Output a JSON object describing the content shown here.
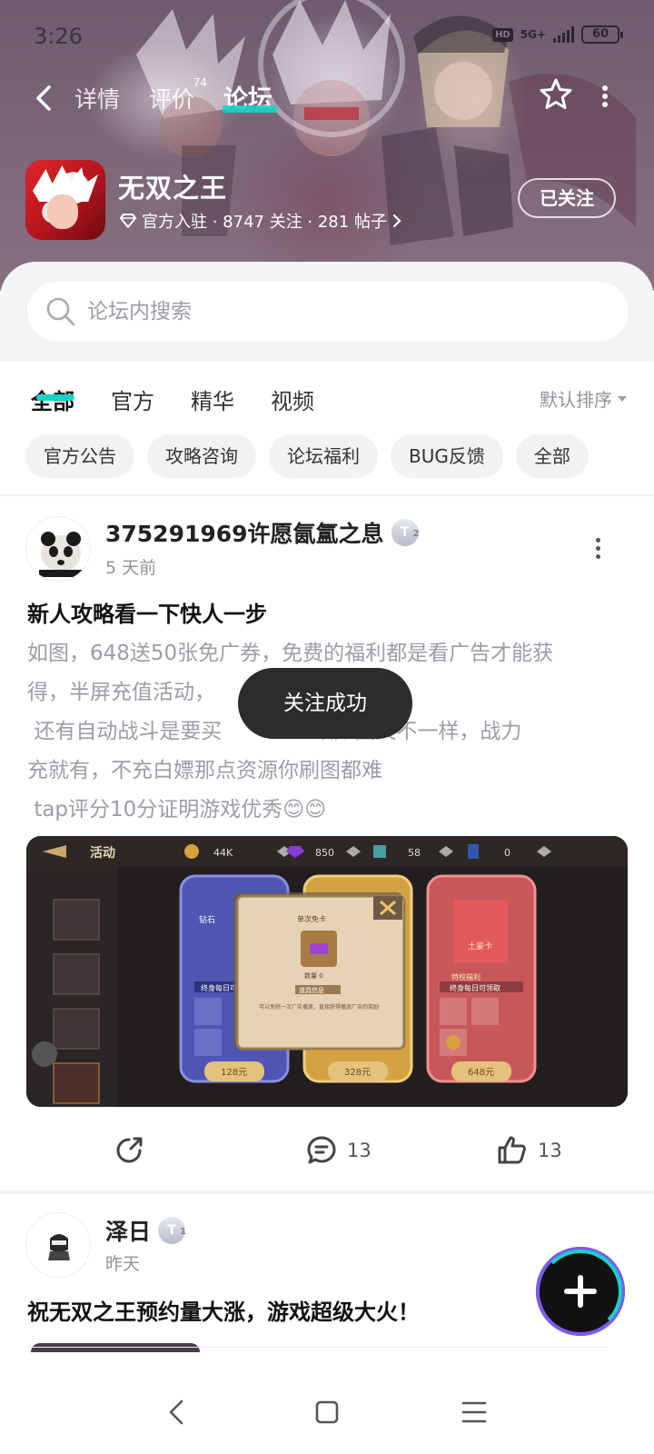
{
  "status_bar": {
    "time": "3:26",
    "hd": "HD",
    "network": "5G+",
    "battery": "60"
  },
  "nav": {
    "tabs": [
      {
        "label": "详情",
        "badge": ""
      },
      {
        "label": "评价",
        "badge": "74"
      },
      {
        "label": "论坛",
        "badge": ""
      }
    ],
    "active_tab": "论坛"
  },
  "game": {
    "title": "无双之王",
    "meta": "官方入驻 · 8747 关注 · 281 帖子",
    "follow_label": "已关注"
  },
  "search": {
    "placeholder": "论坛内搜索"
  },
  "filter_tabs": {
    "items": [
      "全部",
      "官方",
      "精华",
      "视频"
    ],
    "active": "全部",
    "sort_label": "默认排序"
  },
  "chips": [
    "官方公告",
    "攻略咨询",
    "论坛福利",
    "BUG反馈",
    "全部"
  ],
  "posts": [
    {
      "username": "375291969许愿氤氲之息",
      "level": "T",
      "level_sub": "2",
      "time": "5 天前",
      "title": "新人攻略看一下快人一步",
      "body_lines": [
        "如图，648送50张免广券，免费的福利都是看广告才能获",
        "得，半屏充值活动，",
        " 还有自动战斗是要买",
        "充就有，不充白嫖那点资源你刷图都难",
        " tap评分10分证明游戏优秀😊😊"
      ],
      "body_line3_tail": "跟如图又不一样，战力",
      "image": {
        "header_label": "活动",
        "currency": [
          "44K",
          "850",
          "58",
          "0"
        ],
        "popup_title": "单次免卡",
        "popup_count": "数量 0",
        "popup_subtitle": "道具信息",
        "popup_desc": "可以免除一次广告播放，直接获得播放广告的奖励",
        "card_labels": [
          "钻石",
          "特权福利",
          "土豪卡"
        ],
        "card_subtitle": "终身每日可领取",
        "card_prices": [
          "128元",
          "328元",
          "648元"
        ]
      },
      "comments": "13",
      "likes": "13"
    },
    {
      "username": "泽日",
      "level": "T",
      "level_sub": "1",
      "time": "昨天",
      "title": "祝无双之王预约量大涨，游戏超级大火！"
    }
  ],
  "toast": "关注成功",
  "colors": {
    "accent": "#19d2c6",
    "toast_bg": "#2c2c2c",
    "chip_bg": "#f1f2f4"
  },
  "icons": [
    "back-icon",
    "star-icon",
    "more-icon",
    "diamond-icon",
    "chevron-right-icon",
    "search-icon",
    "share-icon",
    "comment-icon",
    "like-icon",
    "plus-icon"
  ]
}
